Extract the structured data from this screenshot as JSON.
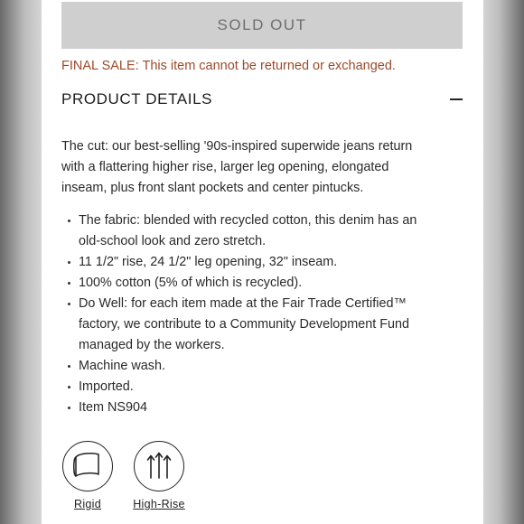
{
  "sold_out_label": "SOLD OUT",
  "final_sale_notice": "FINAL SALE: This item cannot be returned or exchanged.",
  "product_details": {
    "title": "PRODUCT DETAILS",
    "toggle_icon": "minus-icon",
    "description_lines": [
      "The cut: our best-selling '90s-inspired superwide jeans return",
      "with a flattering higher rise, larger leg opening, elongated",
      "inseam, plus front slant pockets and center pintucks."
    ],
    "bullets": [
      {
        "lines": [
          "The fabric: blended with recycled cotton, this denim has an",
          "old-school look and zero stretch."
        ]
      },
      {
        "lines": [
          "11 1/2\" rise, 24 1/2\" leg opening, 32\" inseam."
        ]
      },
      {
        "lines": [
          "100% cotton (5% of which is recycled)."
        ]
      },
      {
        "lines": [
          "Do Well: for each item made at the Fair Trade Certified™",
          "factory, we contribute to a Community Development Fund",
          "managed by the workers."
        ]
      },
      {
        "lines": [
          "Machine wash."
        ]
      },
      {
        "lines": [
          "Imported."
        ]
      },
      {
        "lines": [
          "Item NS904"
        ]
      }
    ]
  },
  "fit_icons": [
    {
      "label": "Rigid",
      "icon": "rigid-fabric-icon"
    },
    {
      "label": "High-Rise",
      "icon": "high-rise-arrows-icon"
    }
  ],
  "colors": {
    "final_sale_text": "#9a4a2c",
    "sold_out_bg": "#cfcfcf",
    "sold_out_text": "#6e6e6e"
  }
}
